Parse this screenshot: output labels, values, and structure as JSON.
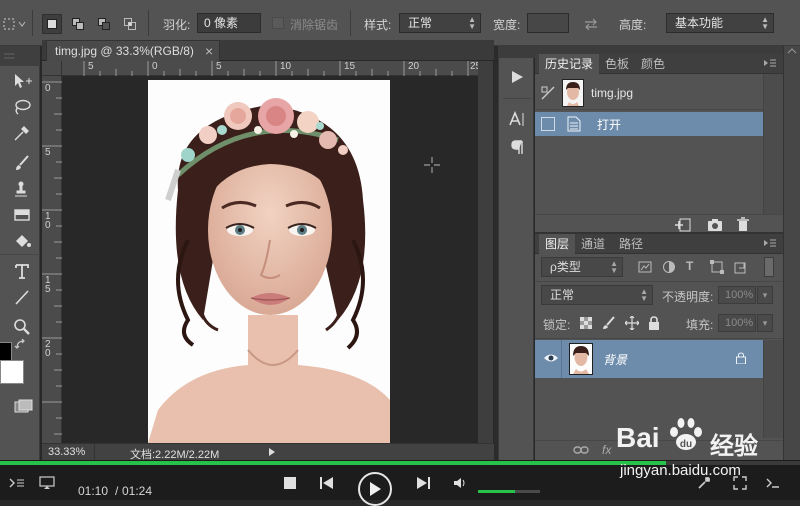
{
  "options_bar": {
    "feather_label": "羽化:",
    "feather_value": "0 像素",
    "antialias_label": "消除锯齿",
    "style_label": "样式:",
    "style_value": "正常",
    "width_label": "宽度:",
    "width_value": "",
    "height_label": "高度:",
    "workspace_value": "基本功能"
  },
  "document": {
    "tab_title": "timg.jpg @ 33.3%(RGB/8)",
    "close_glyph": "×",
    "ruler_h": [
      "5",
      "0",
      "5",
      "10",
      "15",
      "20",
      "25"
    ],
    "ruler_v": [
      "0",
      "5",
      "1\n0",
      "1\n5",
      "2\n0"
    ],
    "zoom": "33.33%",
    "doc_info": "文档:2.22M/2.22M"
  },
  "history_panel": {
    "tabs": [
      "历史记录",
      "色板",
      "颜色"
    ],
    "snapshot_name": "timg.jpg",
    "steps": [
      "打开"
    ]
  },
  "layers_panel": {
    "tabs": [
      "图层",
      "通道",
      "路径"
    ],
    "filter_kind": "ρ类型",
    "blend_mode": "正常",
    "opacity_label": "不透明度:",
    "opacity_value": "100%",
    "lock_label": "锁定:",
    "fill_label": "填充:",
    "fill_value": "100%",
    "layers": [
      {
        "name": "背景",
        "visible": true,
        "locked": true
      }
    ],
    "fx_label": "fx"
  },
  "player": {
    "current_time": "01:10",
    "total_time": "01:24",
    "time_sep": "/",
    "progress": 0.833,
    "volume": 0.6
  },
  "watermark": {
    "brand_left": "Bai",
    "brand_right": "经验",
    "url": "jingyan.baidu.com"
  },
  "colors": {
    "progress_green": "#27c24a",
    "selected_row": "#6d8bab",
    "panel": "#535353"
  }
}
